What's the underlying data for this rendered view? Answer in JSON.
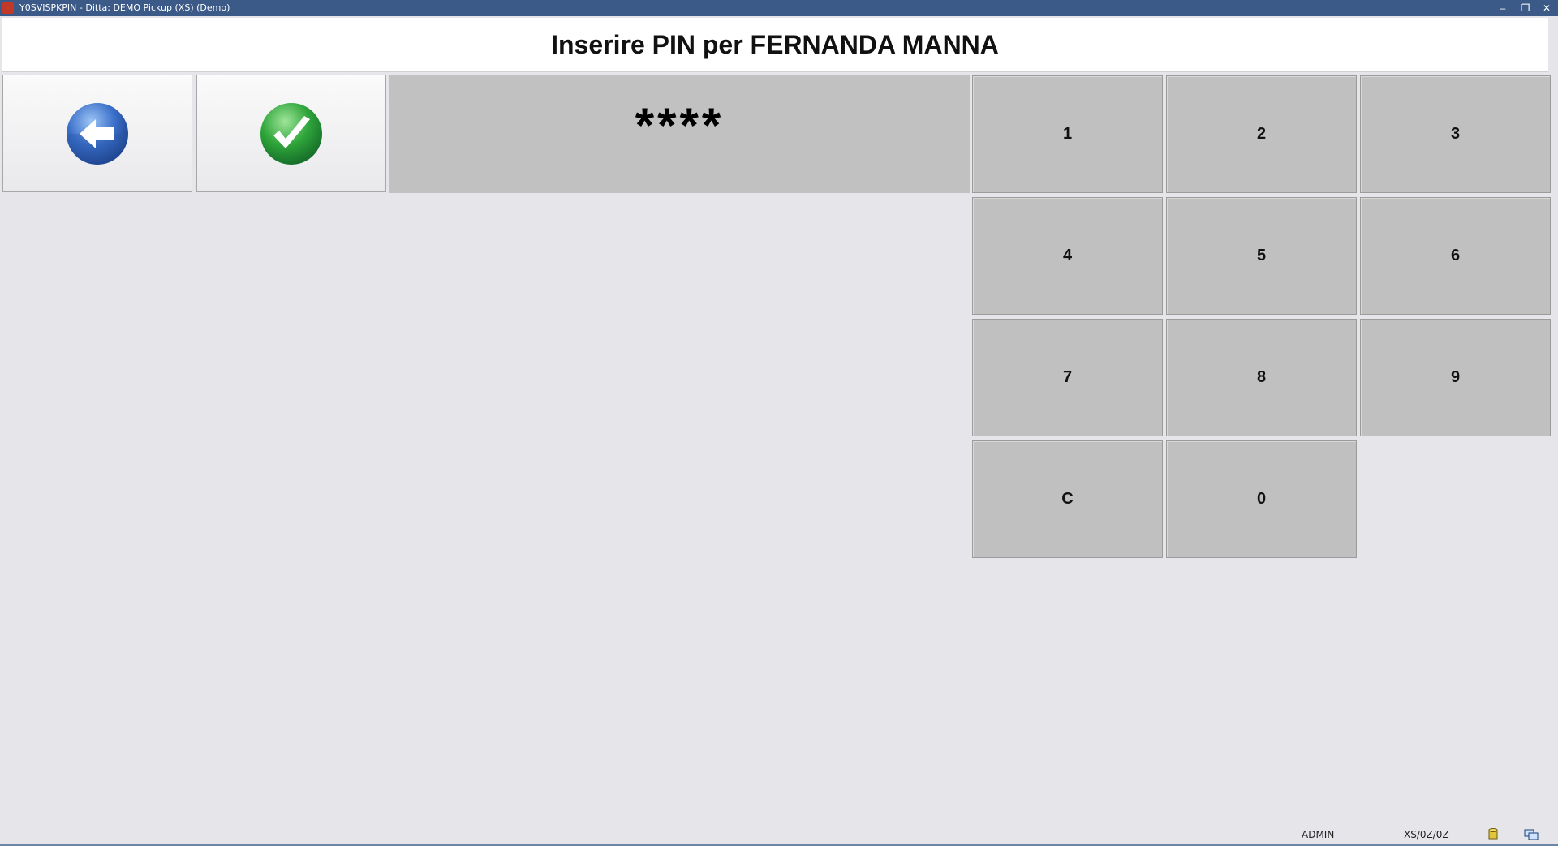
{
  "window": {
    "title": "Y0SVISPKPIN - Ditta: DEMO Pickup (XS)  (Demo)",
    "controls": {
      "minimize": "–",
      "restore": "❐",
      "close": "✕"
    }
  },
  "header": {
    "title": "Inserire PIN per FERNANDA MANNA"
  },
  "toolbar": {
    "back_icon": "arrow-left-circle-icon",
    "confirm_icon": "check-circle-icon"
  },
  "pin": {
    "masked_value": "****"
  },
  "keypad": {
    "k1": "1",
    "k2": "2",
    "k3": "3",
    "k4": "4",
    "k5": "5",
    "k6": "6",
    "k7": "7",
    "k8": "8",
    "k9": "9",
    "kC": "C",
    "k0": "0"
  },
  "status": {
    "user": "ADMIN",
    "code": "XS/0Z/0Z"
  },
  "colors": {
    "titlebar": "#3c5a87",
    "key_bg": "#c0c0c0",
    "background": "#e6e6ea",
    "back_icon": "#3a6fc9",
    "confirm_icon": "#2fa53a"
  }
}
